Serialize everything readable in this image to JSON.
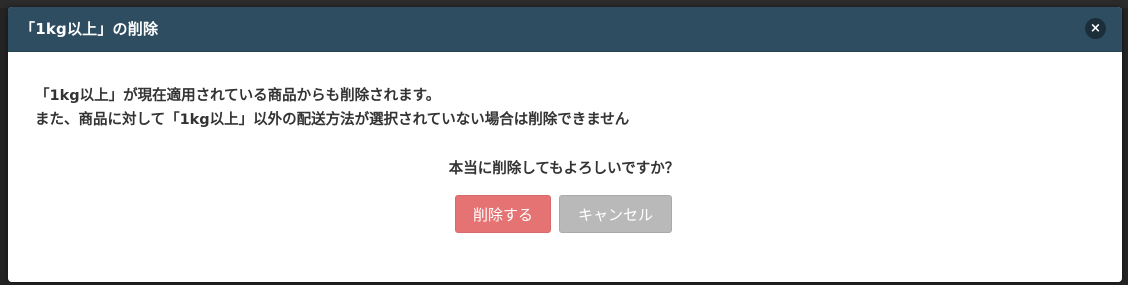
{
  "dialog": {
    "title": "「1kg以上」の削除",
    "close_label": "×",
    "message_line_1": "「1kg以上」が現在適用されている商品からも削除されます。",
    "message_line_2": "また、商品に対して「1kg以上」以外の配送方法が選択されていない場合は削除できません",
    "confirm_question": "本当に削除してもよろしいですか？",
    "delete_button_label": "削除する",
    "cancel_button_label": "キャンセル"
  },
  "colors": {
    "header_bg": "#2f4d61",
    "delete_button_bg": "#e57373",
    "cancel_button_bg": "#b9b9b9"
  }
}
